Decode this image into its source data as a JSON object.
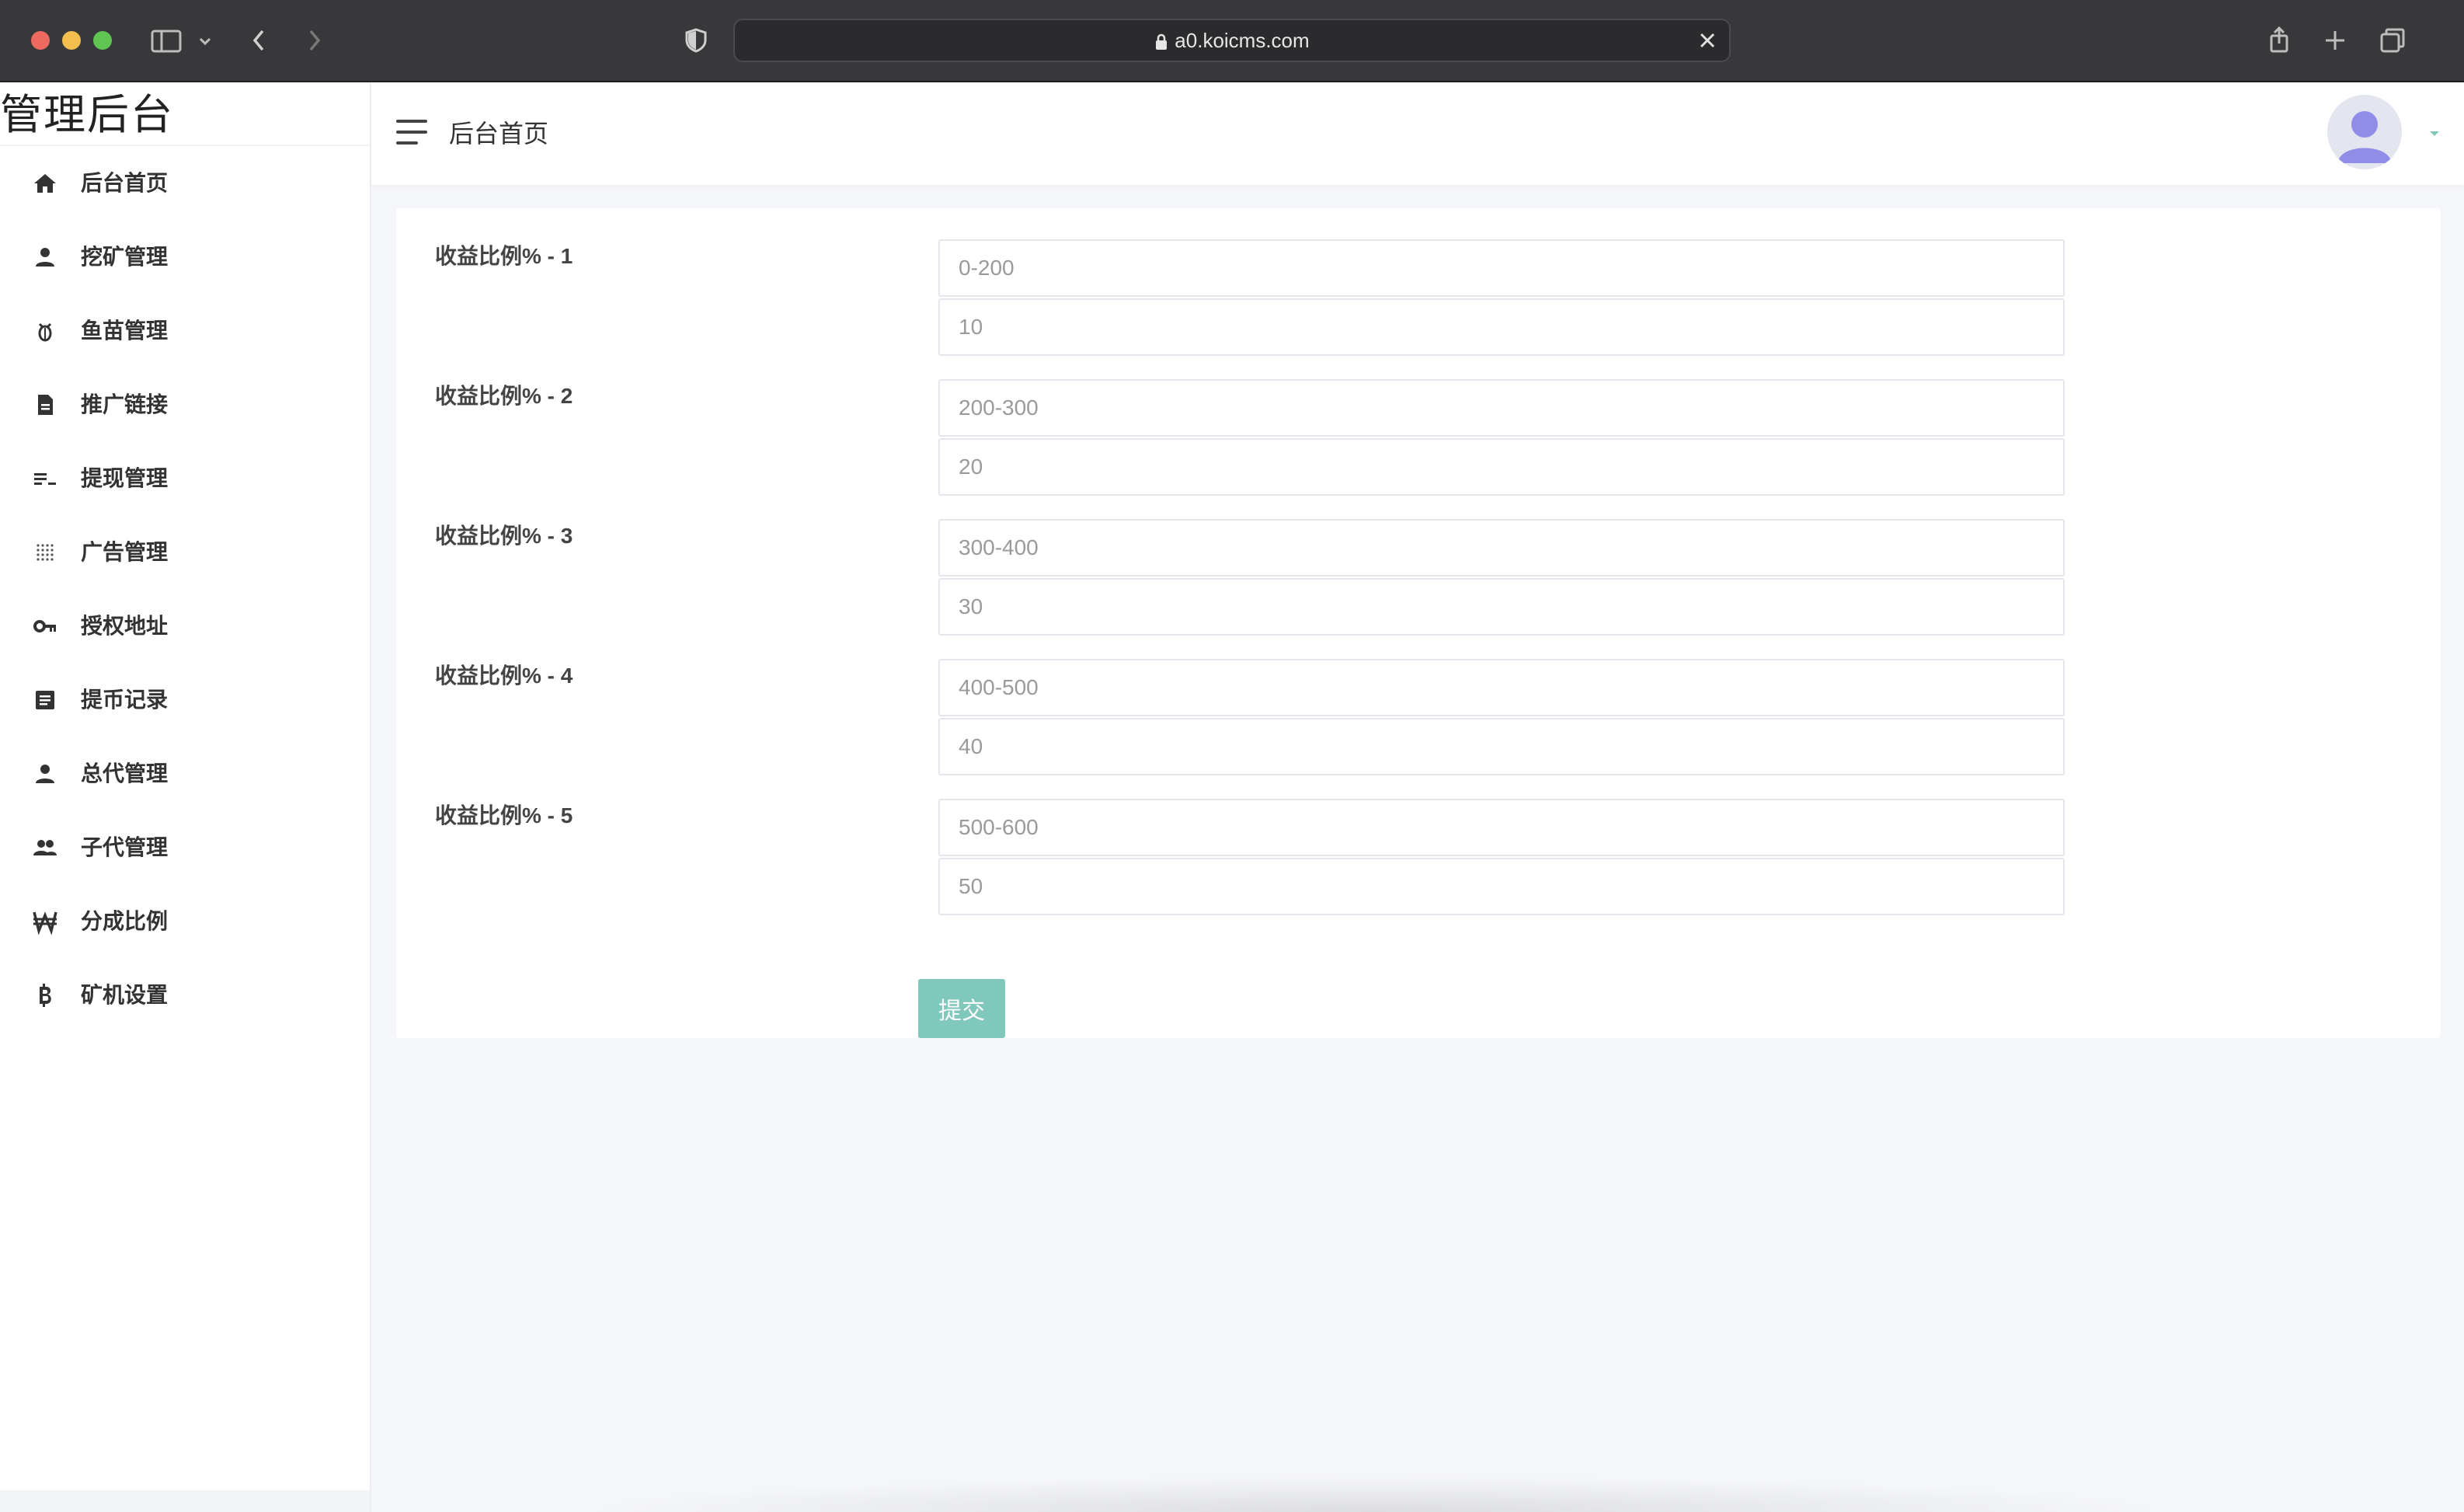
{
  "browser": {
    "url": "a0.koicms.com"
  },
  "sidebar": {
    "brand": "管理后台",
    "items": [
      {
        "label": "后台首页",
        "icon": "home-icon"
      },
      {
        "label": "挖矿管理",
        "icon": "person-icon"
      },
      {
        "label": "鱼苗管理",
        "icon": "bug-icon"
      },
      {
        "label": "推广链接",
        "icon": "document-icon"
      },
      {
        "label": "提现管理",
        "icon": "list-icon"
      },
      {
        "label": "广告管理",
        "icon": "dot-grid-icon"
      },
      {
        "label": "授权地址",
        "icon": "key-icon"
      },
      {
        "label": "提币记录",
        "icon": "record-icon"
      },
      {
        "label": "总代管理",
        "icon": "person-icon"
      },
      {
        "label": "子代管理",
        "icon": "people-icon"
      },
      {
        "label": "分成比例",
        "icon": "won-icon"
      },
      {
        "label": "矿机设置",
        "icon": "bitcoin-icon"
      }
    ]
  },
  "header": {
    "breadcrumb": "后台首页"
  },
  "form": {
    "rows": [
      {
        "label": "收益比例% - 1",
        "range": "0-200",
        "rate": "10"
      },
      {
        "label": "收益比例% - 2",
        "range": "200-300",
        "rate": "20"
      },
      {
        "label": "收益比例% - 3",
        "range": "300-400",
        "rate": "30"
      },
      {
        "label": "收益比例% - 4",
        "range": "400-500",
        "rate": "40"
      },
      {
        "label": "收益比例% - 5",
        "range": "500-600",
        "rate": "50"
      }
    ],
    "submit_label": "提交"
  },
  "colors": {
    "accent": "#80c7bc",
    "chrome": "#38383b",
    "avatar": "#8f8de8"
  }
}
